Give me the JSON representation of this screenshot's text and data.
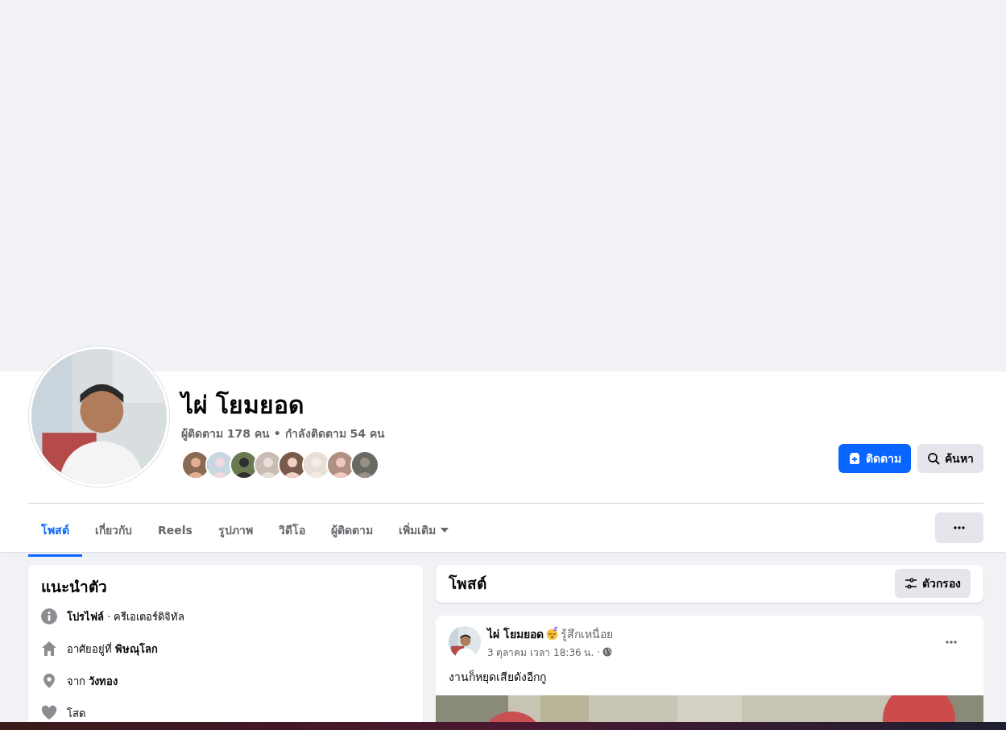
{
  "profile": {
    "name": "ไผ่ โยมยอด",
    "stats": "ผู้ติดตาม 178 คน • กำลังติดตาม 54 คน"
  },
  "actions": [
    {
      "kind": "follow",
      "label": "ติดตาม"
    },
    {
      "kind": "search",
      "label": "ค้นหา"
    }
  ],
  "tabs": [
    {
      "label": "โพสต์",
      "selected": true
    },
    {
      "label": "เกี่ยวกับ",
      "selected": false
    },
    {
      "label": "Reels",
      "selected": false
    },
    {
      "label": "รูปภาพ",
      "selected": false
    },
    {
      "label": "วิดีโอ",
      "selected": false
    },
    {
      "label": "ผู้ติดตาม",
      "selected": false
    },
    {
      "label": "เพิ่มเติม",
      "selected": false,
      "dropdown": true
    }
  ],
  "intro": {
    "title": "แนะนำตัว",
    "items": [
      {
        "kind": "info",
        "text": "**โปรไฟล์** · ครีเอเตอร์ดิจิทัล"
      },
      {
        "kind": "home",
        "text": "อาศัยอยู่ที่ **พิษณุโลก**"
      },
      {
        "kind": "pin",
        "text": "จาก **วังทอง**"
      },
      {
        "kind": "heart",
        "text": "โสด"
      }
    ]
  },
  "posts_header": {
    "title": "โพสต์",
    "filter_button": "ตัวกรอง"
  },
  "post": {
    "author": "ไผ่ โยมยอด",
    "feeling": "รู้สึกเหนื่อย",
    "time": "3 ตุลาคม เวลา 18:36 น. ·",
    "text": "งานก็หยุดเสียดังอีกกู"
  }
}
